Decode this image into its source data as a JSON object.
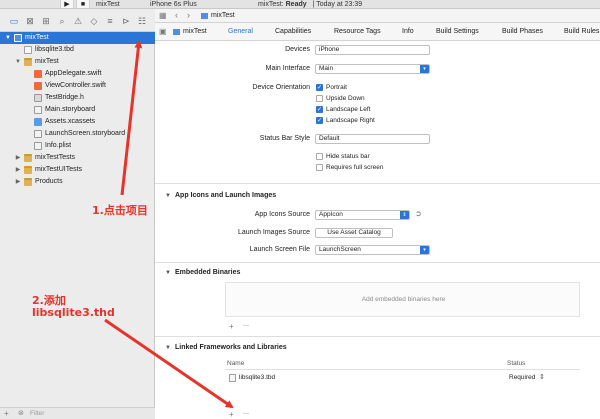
{
  "toolbar": {
    "scheme": "mixTest",
    "device": "iPhone 6s Plus",
    "status_app": "mixTest:",
    "status_state": "Ready",
    "status_time": "Today at 23:39"
  },
  "navigator": {
    "items": [
      {
        "label": "mixTest",
        "level": 0,
        "icon": "project-icon",
        "disclosure": "open",
        "selected": true
      },
      {
        "label": "libsqlite3.tbd",
        "level": 1,
        "icon": "tbd-file-icon",
        "disclosure": "",
        "selected": false
      },
      {
        "label": "mixTest",
        "level": 1,
        "icon": "folder-icon",
        "disclosure": "open",
        "selected": false
      },
      {
        "label": "AppDelegate.swift",
        "level": 2,
        "icon": "swift-file-icon",
        "disclosure": "",
        "selected": false
      },
      {
        "label": "ViewController.swift",
        "level": 2,
        "icon": "swift-file-icon",
        "disclosure": "",
        "selected": false
      },
      {
        "label": "TestBridge.h",
        "level": 2,
        "icon": "header-file-icon",
        "disclosure": "",
        "selected": false
      },
      {
        "label": "Main.storyboard",
        "level": 2,
        "icon": "storyboard-file-icon",
        "disclosure": "",
        "selected": false
      },
      {
        "label": "Assets.xcassets",
        "level": 2,
        "icon": "assets-icon",
        "disclosure": "",
        "selected": false
      },
      {
        "label": "LaunchScreen.storyboard",
        "level": 2,
        "icon": "storyboard-file-icon",
        "disclosure": "",
        "selected": false
      },
      {
        "label": "Info.plist",
        "level": 2,
        "icon": "plist-file-icon",
        "disclosure": "",
        "selected": false
      },
      {
        "label": "mixTestTests",
        "level": 1,
        "icon": "folder-icon",
        "disclosure": "closed",
        "selected": false
      },
      {
        "label": "mixTestUITests",
        "level": 1,
        "icon": "folder-icon",
        "disclosure": "closed",
        "selected": false
      },
      {
        "label": "Products",
        "level": 1,
        "icon": "folder-icon",
        "disclosure": "closed",
        "selected": false
      }
    ],
    "filter_placeholder": "Filter"
  },
  "editor": {
    "breadcrumb": "mixTest",
    "target": "mixTest",
    "tabs": [
      "General",
      "Capabilities",
      "Resource Tags",
      "Info",
      "Build Settings",
      "Build Phases",
      "Build Rules"
    ],
    "active_tab": "General"
  },
  "deployment": {
    "devices_label": "Devices",
    "devices_value": "iPhone",
    "main_interface_label": "Main Interface",
    "main_interface_value": "Main",
    "orientation_label": "Device Orientation",
    "orientations": [
      {
        "label": "Portrait",
        "checked": true
      },
      {
        "label": "Upside Down",
        "checked": false
      },
      {
        "label": "Landscape Left",
        "checked": true
      },
      {
        "label": "Landscape Right",
        "checked": true
      }
    ],
    "status_bar_label": "Status Bar Style",
    "status_bar_value": "Default",
    "status_options": [
      {
        "label": "Hide status bar",
        "checked": false
      },
      {
        "label": "Requires full screen",
        "checked": false
      }
    ]
  },
  "app_icons": {
    "heading": "App Icons and Launch Images",
    "icons_source_label": "App Icons Source",
    "icons_source_value": "AppIcon",
    "launch_images_label": "Launch Images Source",
    "launch_images_button": "Use Asset Catalog",
    "launch_file_label": "Launch Screen File",
    "launch_file_value": "LaunchScreen"
  },
  "embedded": {
    "heading": "Embedded Binaries",
    "empty_text": "Add embedded binaries here",
    "add": "+",
    "remove": "—"
  },
  "linked": {
    "heading": "Linked Frameworks and Libraries",
    "col_name": "Name",
    "col_status": "Status",
    "rows": [
      {
        "name": "libsqlite3.tbd",
        "status": "Required"
      }
    ],
    "add": "+",
    "remove": "—"
  },
  "annotations": {
    "step1": "1.点击项目",
    "step2_line1": "2.添加",
    "step2_line2": "libsqlite3.thd",
    "color": "#e8332a"
  },
  "colors": {
    "accent": "#2a75d6",
    "annotation": "#e8332a"
  }
}
